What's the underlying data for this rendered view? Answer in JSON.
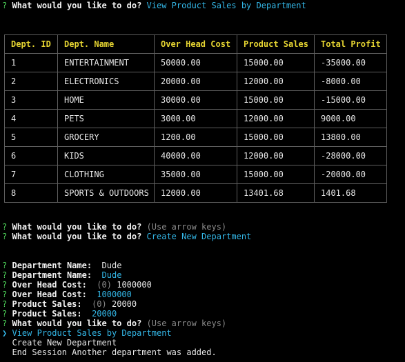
{
  "prompt_mark": "?",
  "question": "What would you like to do?",
  "first_answer": "View Product Sales by Department",
  "table": {
    "headers": [
      "Dept. ID",
      "Dept. Name",
      "Over Head Cost",
      "Product Sales",
      "Total Profit"
    ],
    "rows": [
      [
        "1",
        "ENTERTAINMENT",
        "50000.00",
        "15000.00",
        "-35000.00"
      ],
      [
        "2",
        "ELECTRONICS",
        "20000.00",
        "12000.00",
        "-8000.00"
      ],
      [
        "3",
        "HOME",
        "30000.00",
        "15000.00",
        "-15000.00"
      ],
      [
        "4",
        "PETS",
        "3000.00",
        "12000.00",
        "9000.00"
      ],
      [
        "5",
        "GROCERY",
        "1200.00",
        "15000.00",
        "13800.00"
      ],
      [
        "6",
        "KIDS",
        "40000.00",
        "12000.00",
        "-28000.00"
      ],
      [
        "7",
        "CLOTHING",
        "35000.00",
        "15000.00",
        "-20000.00"
      ],
      [
        "8",
        "SPORTS & OUTDOORS",
        "12000.00",
        "13401.68",
        "1401.68"
      ]
    ]
  },
  "hint": "(Use arrow keys)",
  "second_answer": "Create New Department",
  "form": {
    "dept_name_label": "Department Name:",
    "dept_name_typed": "Dude",
    "dept_name_value": "Dude",
    "overhead_label": "Over Head Cost:",
    "overhead_default": "(0)",
    "overhead_typed": "1000000",
    "overhead_value": "1000000",
    "sales_label": "Product Sales:",
    "sales_default": "(0)",
    "sales_typed": "20000",
    "sales_value": "20000"
  },
  "menu": {
    "pointer": "❯",
    "options": [
      "View Product Sales by Department",
      "Create New Department",
      "End Session"
    ]
  },
  "confirmation": "Another department was added."
}
